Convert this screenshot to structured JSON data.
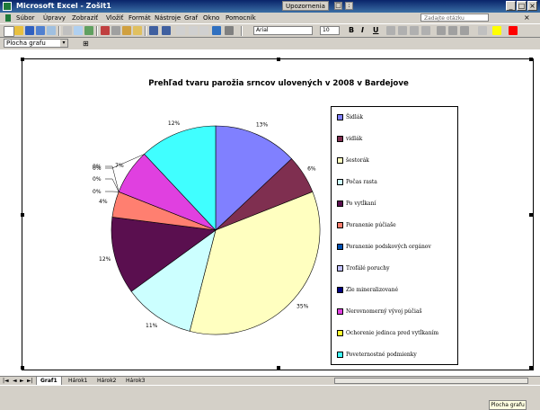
{
  "window": {
    "title": "Microsoft Excel - Zošit1",
    "taskbar_label": "Upozornenia",
    "controls": [
      "_",
      "□",
      "×"
    ]
  },
  "menu": {
    "items": [
      "Súbor",
      "Úpravy",
      "Zobraziť",
      "Vložiť",
      "Formát",
      "Nástroje",
      "Graf",
      "Okno",
      "Pomocník"
    ],
    "help_placeholder": "Zadajte otázku",
    "doc_close": "×"
  },
  "toolbar": {
    "font_name": "Arial",
    "font_size": "10",
    "bold": "B",
    "italic": "I",
    "underline": "U"
  },
  "chart_area_selector": {
    "value": "Plocha grafu",
    "arrow": "▾"
  },
  "chart_data": {
    "type": "pie",
    "title": "Prehľad tvaru parožia srncov ulovených v 2008 v Bardejove",
    "categories": [
      "Šidlák",
      "vidlák",
      "šestorák",
      "Počas rasta",
      "Po vytĺkaní",
      "Poranenie púčiaše",
      "Poranenie podskových orgánov",
      "Trofálé poruchy",
      "Zle mineralizované",
      "Nerovnomerný vývoj púčiaš",
      "Ochorenie jedinca pred vytĺkaním",
      "Poveternostné podmienky"
    ],
    "values": [
      13,
      6,
      35,
      11,
      12,
      4,
      0,
      0,
      0,
      7,
      0,
      12
    ],
    "data_labels": [
      "13%",
      "6%",
      "35%",
      "11%",
      "12%",
      "4%",
      "0%",
      "0%",
      "0%",
      "7%",
      "0%",
      "12%"
    ],
    "colors": [
      "#8080ff",
      "#7f2f50",
      "#ffffc0",
      "#ccffff",
      "#5a0f4f",
      "#ff7f70",
      "#0050b0",
      "#c0c0ff",
      "#000080",
      "#e040e0",
      "#ffff30",
      "#40ffff"
    ],
    "legend_position": "right",
    "start_angle_deg": 0,
    "direction": "clockwise"
  },
  "chart_toolbar": {
    "label": "Plocha grafu"
  },
  "sheet_tabs": {
    "nav": [
      "|◄",
      "◄",
      "►",
      "►|"
    ],
    "tabs": [
      "Graf1",
      "Hárok1",
      "Hárok2",
      "Hárok3"
    ],
    "active": 0
  },
  "colors": {
    "titlebar": "#0a246a",
    "chrome": "#d4d0c8"
  }
}
